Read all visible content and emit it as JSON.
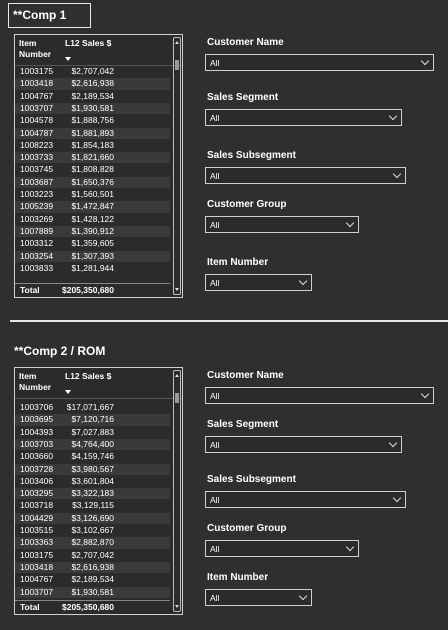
{
  "comp1": {
    "title": "**Comp 1",
    "table": {
      "col_item": "Item Number",
      "col_sales": "L12 Sales $",
      "rows": [
        [
          "1003175",
          "$2,707,042"
        ],
        [
          "1003418",
          "$2,616,938"
        ],
        [
          "1004767",
          "$2,189,534"
        ],
        [
          "1003707",
          "$1,930,581"
        ],
        [
          "1004578",
          "$1,888,756"
        ],
        [
          "1004787",
          "$1,881,893"
        ],
        [
          "1008223",
          "$1,854,183"
        ],
        [
          "1003733",
          "$1,821,660"
        ],
        [
          "1003745",
          "$1,808,828"
        ],
        [
          "1003687",
          "$1,650,376"
        ],
        [
          "1003223",
          "$1,560,501"
        ],
        [
          "1005239",
          "$1,472,847"
        ],
        [
          "1003269",
          "$1,428,122"
        ],
        [
          "1007889",
          "$1,390,912"
        ],
        [
          "1003312",
          "$1,359,605"
        ],
        [
          "1003254",
          "$1,307,393"
        ],
        [
          "1003833",
          "$1,281,944"
        ]
      ],
      "total_label": "Total",
      "total_value": "$205,350,680"
    },
    "filters": [
      {
        "label": "Customer Name",
        "value": "All"
      },
      {
        "label": "Sales Segment",
        "value": "All"
      },
      {
        "label": "Sales Subsegment",
        "value": "All"
      },
      {
        "label": "Customer Group",
        "value": "All"
      },
      {
        "label": "Item Number",
        "value": "All"
      }
    ]
  },
  "comp2": {
    "title": "**Comp 2 / ROM",
    "table": {
      "col_item": "Item Number",
      "col_sales": "L12 Sales $",
      "rows": [
        [
          "1003706",
          "$17,071,667"
        ],
        [
          "1003695",
          "$7,120,716"
        ],
        [
          "1004393",
          "$7,027,883"
        ],
        [
          "1003703",
          "$4,764,400"
        ],
        [
          "1003660",
          "$4,159,746"
        ],
        [
          "1003728",
          "$3,980,567"
        ],
        [
          "1003406",
          "$3,601,804"
        ],
        [
          "1003295",
          "$3,322,183"
        ],
        [
          "1003718",
          "$3,129,115"
        ],
        [
          "1004429",
          "$3,126,690"
        ],
        [
          "1003515",
          "$3,102,667"
        ],
        [
          "1003363",
          "$2,882,870"
        ],
        [
          "1003175",
          "$2,707,042"
        ],
        [
          "1003418",
          "$2,616,938"
        ],
        [
          "1004767",
          "$2,189,534"
        ],
        [
          "1003707",
          "$1,930,581"
        ]
      ],
      "total_label": "Total",
      "total_value": "$205,350,680"
    },
    "filters": [
      {
        "label": "Customer Name",
        "value": "All"
      },
      {
        "label": "Sales Segment",
        "value": "All"
      },
      {
        "label": "Sales Subsegment",
        "value": "All"
      },
      {
        "label": "Customer Group",
        "value": "All"
      },
      {
        "label": "Item Number",
        "value": "All"
      }
    ]
  }
}
